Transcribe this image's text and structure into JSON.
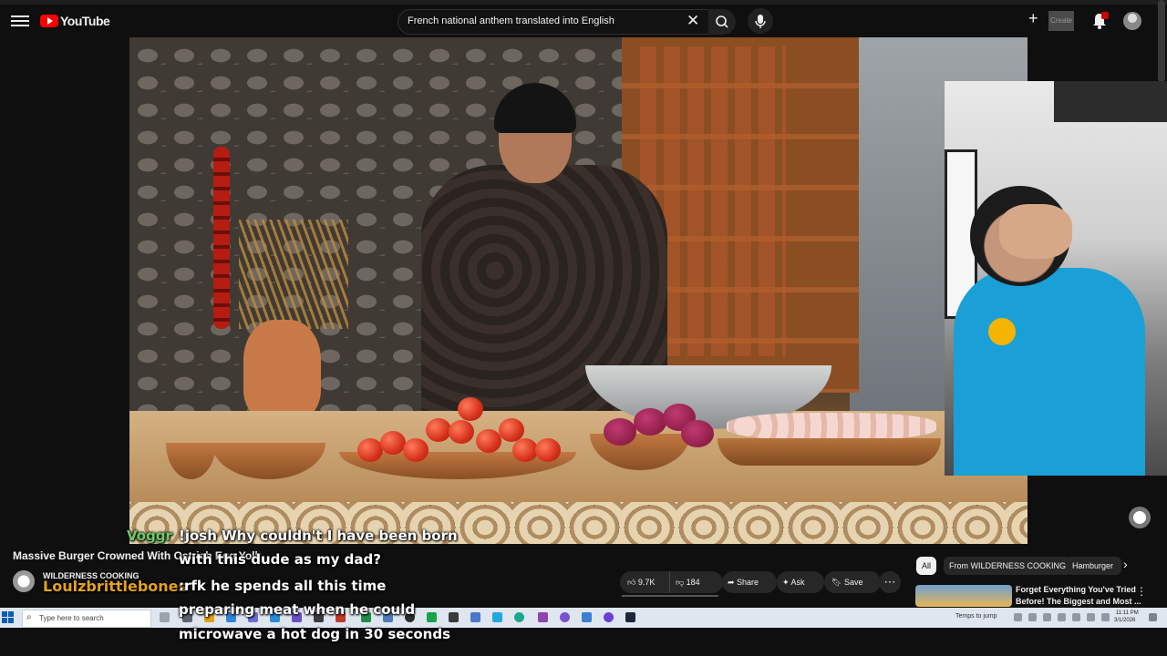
{
  "app": {
    "logo_text": "YouTube"
  },
  "header": {
    "search_value": "French national anthem translated into English",
    "create_label": "Create"
  },
  "video": {
    "title": "Massive Burger Crowned With Ostrich Egg Yolk",
    "channel": "WILDERNESS COOKING",
    "likes": "9.7K",
    "dislikes": "184",
    "share_label": "Share",
    "ask_label": "Ask",
    "save_label": "Save"
  },
  "chat": {
    "user1": "Voggr",
    "msg1": "!josh Why couldn't I have been born",
    "msg2": "with this dude as my dad?",
    "user2": "Loulzbrittlebones",
    "msg3": ":rfk he spends all this time",
    "msg4": "preparing meat when he could",
    "msg5": "microwave a hot dog in 30 seconds"
  },
  "sidebar": {
    "chips": [
      "All",
      "From WILDERNESS COOKING",
      "Hamburger"
    ],
    "rec_title_line1": "Forget Everything You've Tried",
    "rec_title_line2": "Before! The Biggest and Most ..."
  },
  "taskbar": {
    "search_placeholder": "Type here to search",
    "tray_text": "Temps to jump",
    "clock_time": "11:11 PM",
    "clock_date": "3/1/2026"
  },
  "colors": {
    "youtube_red": "#ff0000",
    "background": "#0f0f0f",
    "chat_user1": "#6acb63",
    "chat_user2": "#e5a21a"
  }
}
